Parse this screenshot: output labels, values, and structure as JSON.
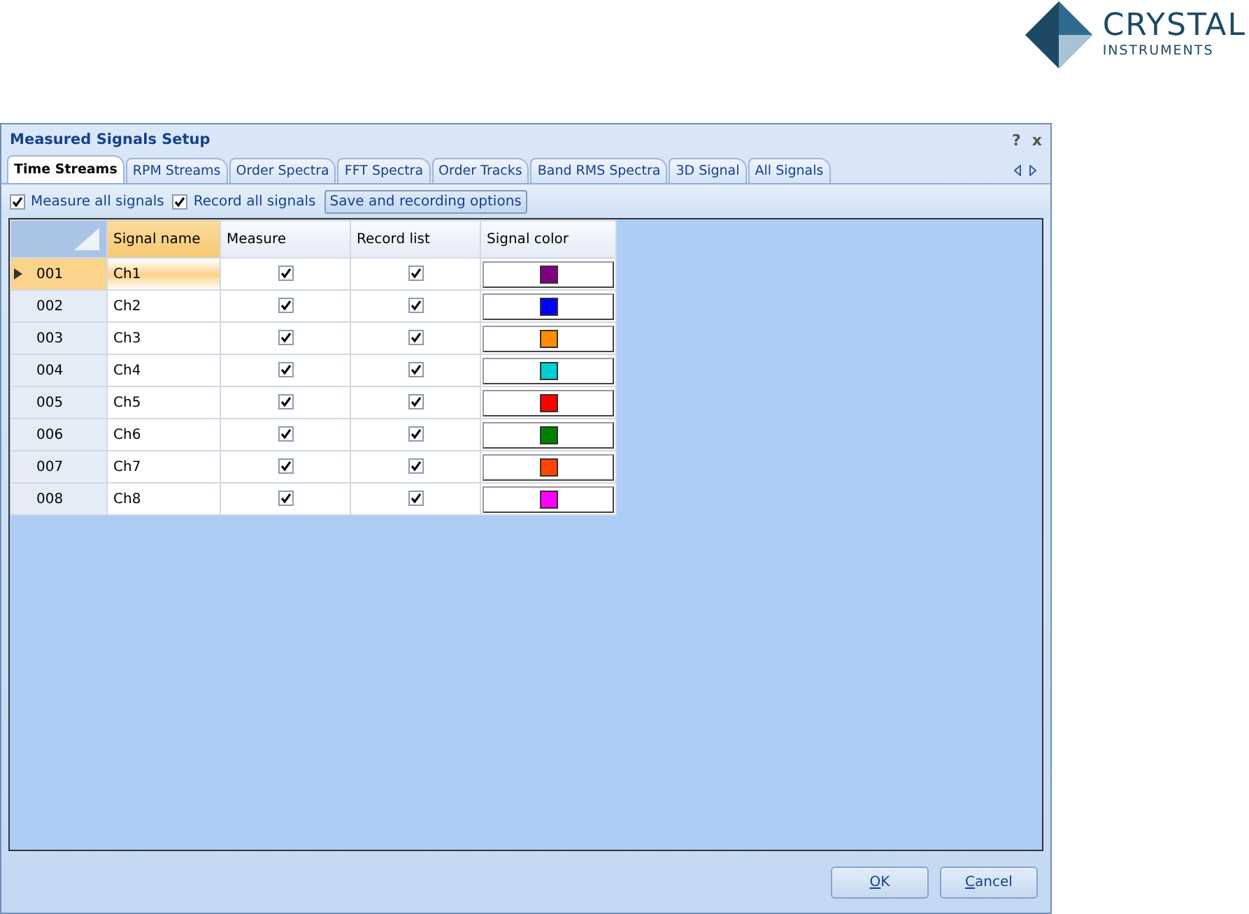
{
  "logo": {
    "line1": "CRYSTAL",
    "line2": "INSTRUMENTS"
  },
  "window": {
    "title": "Measured Signals Setup",
    "help": "?",
    "close": "x"
  },
  "tabs": [
    {
      "label": "Time Streams",
      "selected": true
    },
    {
      "label": "RPM Streams",
      "selected": false
    },
    {
      "label": "Order Spectra",
      "selected": false
    },
    {
      "label": "FFT Spectra",
      "selected": false
    },
    {
      "label": "Order Tracks",
      "selected": false
    },
    {
      "label": "Band RMS Spectra",
      "selected": false
    },
    {
      "label": "3D Signal",
      "selected": false
    },
    {
      "label": "All Signals",
      "selected": false
    }
  ],
  "toolbar": {
    "measure_all": {
      "label": "Measure all signals",
      "checked": true
    },
    "record_all": {
      "label": "Record all signals",
      "checked": true
    },
    "options_button": "Save and recording options"
  },
  "table": {
    "columns": [
      "Signal name",
      "Measure",
      "Record list",
      "Signal color"
    ],
    "rows": [
      {
        "id": "001",
        "name": "Ch1",
        "measure": true,
        "record": true,
        "color": "#800080",
        "selected": true
      },
      {
        "id": "002",
        "name": "Ch2",
        "measure": true,
        "record": true,
        "color": "#0000ff",
        "selected": false
      },
      {
        "id": "003",
        "name": "Ch3",
        "measure": true,
        "record": true,
        "color": "#ff8c00",
        "selected": false
      },
      {
        "id": "004",
        "name": "Ch4",
        "measure": true,
        "record": true,
        "color": "#00ced1",
        "selected": false
      },
      {
        "id": "005",
        "name": "Ch5",
        "measure": true,
        "record": true,
        "color": "#ff0000",
        "selected": false
      },
      {
        "id": "006",
        "name": "Ch6",
        "measure": true,
        "record": true,
        "color": "#008000",
        "selected": false
      },
      {
        "id": "007",
        "name": "Ch7",
        "measure": true,
        "record": true,
        "color": "#ff4500",
        "selected": false
      },
      {
        "id": "008",
        "name": "Ch8",
        "measure": true,
        "record": true,
        "color": "#ff00ff",
        "selected": false
      }
    ]
  },
  "buttons": [
    "OK",
    "Cancel"
  ]
}
